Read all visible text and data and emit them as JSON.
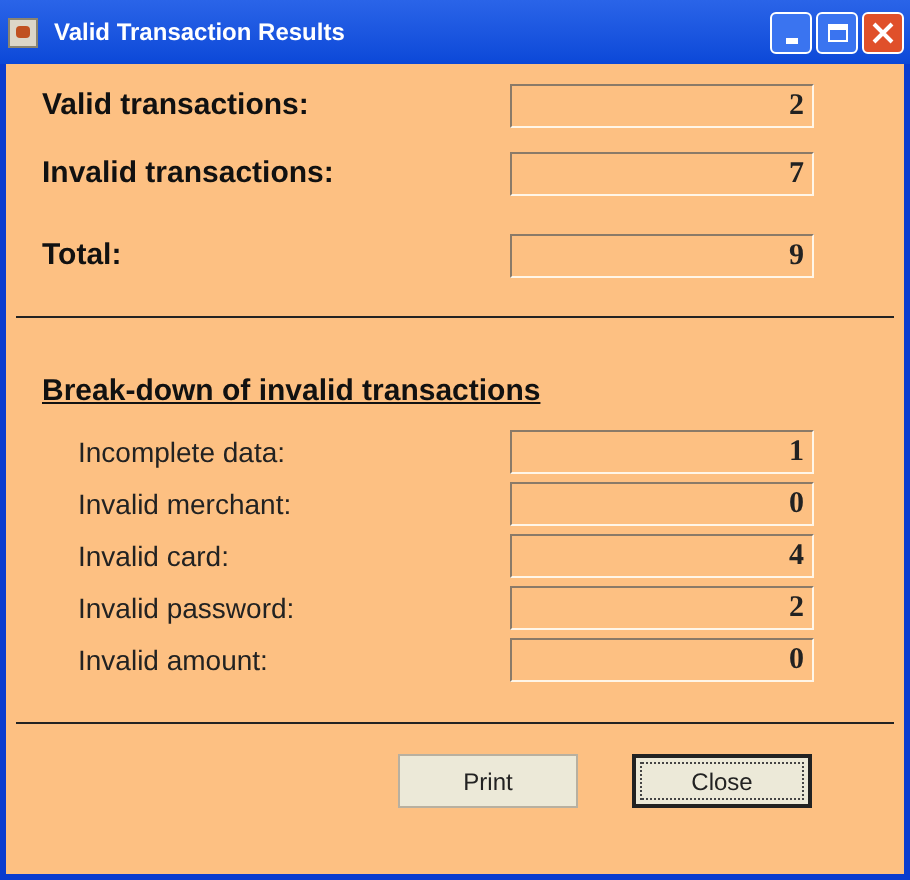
{
  "window": {
    "title": "Valid Transaction Results"
  },
  "summary": [
    {
      "label": "Valid transactions:",
      "value": "2"
    },
    {
      "label": "Invalid transactions:",
      "value": "7"
    },
    {
      "label": "Total:",
      "value": "9"
    }
  ],
  "breakdown": {
    "heading": "Break-down of invalid transactions",
    "rows": [
      {
        "label": "Incomplete data:",
        "value": "1"
      },
      {
        "label": "Invalid merchant:",
        "value": "0"
      },
      {
        "label": "Invalid card:",
        "value": "4"
      },
      {
        "label": "Invalid password:",
        "value": "2"
      },
      {
        "label": "Invalid amount:",
        "value": "0"
      }
    ]
  },
  "buttons": [
    {
      "label": "Print",
      "focused": false
    },
    {
      "label": "Close",
      "focused": true
    }
  ]
}
